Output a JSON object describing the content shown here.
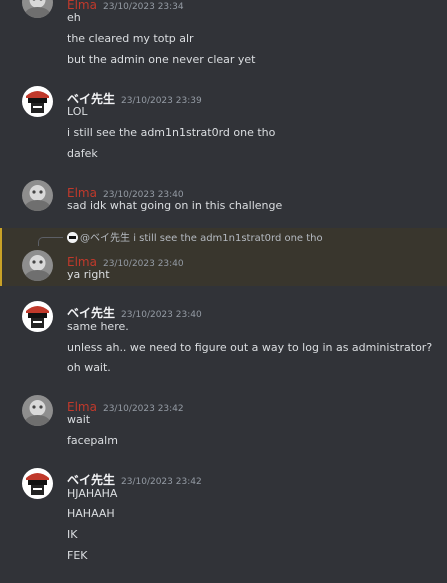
{
  "colors": {
    "background": "#313338",
    "elma_name": "#c0392b",
    "bei_name": "#f2f3f5",
    "timestamp": "#949ba4",
    "highlight": "#39362d",
    "highlight_bar": "#c9a227"
  },
  "messages": [
    {
      "user": "Elma",
      "timestamp": "23/10/2023 23:34",
      "lines": [
        "eh",
        "the cleared my totp alr",
        "but the admin one never clear yet"
      ]
    },
    {
      "user": "ベイ先生",
      "timestamp": "23/10/2023 23:39",
      "lines": [
        "LOL",
        "i still see the adm1n1strat0rd one tho",
        "dafek"
      ]
    },
    {
      "user": "Elma",
      "timestamp": "23/10/2023 23:40",
      "lines": [
        "sad idk what going on in this challenge"
      ]
    },
    {
      "user": "Elma",
      "timestamp": "23/10/2023 23:40",
      "reply": {
        "user": "@ベイ先生",
        "text": "i still see the adm1n1strat0rd one tho"
      },
      "lines": [
        "ya right"
      ]
    },
    {
      "user": "ベイ先生",
      "timestamp": "23/10/2023 23:40",
      "lines": [
        "same here.",
        "unless ah.. we need to figure out a way to log in as administrator?",
        "oh wait."
      ]
    },
    {
      "user": "Elma",
      "timestamp": "23/10/2023 23:42",
      "lines": [
        "wait",
        "facepalm"
      ]
    },
    {
      "user": "ベイ先生",
      "timestamp": "23/10/2023 23:42",
      "lines": [
        "HJAHAHA",
        "HAHAAH",
        "IK",
        "FEK"
      ]
    }
  ]
}
